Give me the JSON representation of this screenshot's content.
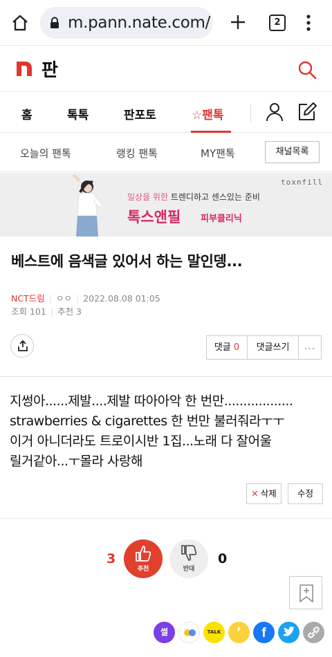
{
  "browser": {
    "url": "m.pann.nate.com/",
    "tab_count": "2"
  },
  "header": {
    "logo_text": "판"
  },
  "main_tabs": [
    {
      "label": "홈"
    },
    {
      "label": "톡톡"
    },
    {
      "label": "판포토"
    },
    {
      "label": "☆팬톡",
      "active": true
    }
  ],
  "sub_tabs": [
    {
      "label": "오늘의 팬톡"
    },
    {
      "label": "랭킹 팬톡"
    },
    {
      "label": "MY팬톡"
    }
  ],
  "channel_button": "채널목록",
  "ad": {
    "brand": "toxnfill",
    "tag_highlight": "일상을 위한",
    "tag_rest": " 트렌디하고 센스있는 준비",
    "title": "톡스앤필",
    "subtitle": "피부클리닉"
  },
  "post": {
    "title": "베스트에 음색글 있어서 하는 말인뎅...",
    "category": "NCT드림",
    "author": "ㅇㅇ",
    "date": "2022.08.08 01:05",
    "views": "조회 101",
    "recommend": "추천 3",
    "body_lines": [
      "지썽아......제발....제발 따아아악 한 번만..................",
      "strawberries & cigarettes 한 번만 불러줘라ㅜㅜ",
      "이거 아니더라도 트로이시반 1집...노래 다 잘어울",
      "릴거같아...ㅜ몰라 사랑해"
    ]
  },
  "actions": {
    "comment_label": "댓글",
    "comment_count": "0",
    "write_comment": "댓글쓰기",
    "more": "...",
    "delete_label": "삭제",
    "edit_label": "수정"
  },
  "votes": {
    "up_count": "3",
    "up_label": "추천",
    "down_label": "반대",
    "down_count": "0"
  },
  "share": {
    "ssul_label": "썰",
    "kakao_label": "TALK",
    "story_label": "’",
    "facebook_label": "f"
  },
  "colors": {
    "accent": "#e1362f",
    "ad_pink": "#d92760",
    "facebook": "#1877f2",
    "twitter": "#1da1f2",
    "kakao": "#fae100"
  }
}
